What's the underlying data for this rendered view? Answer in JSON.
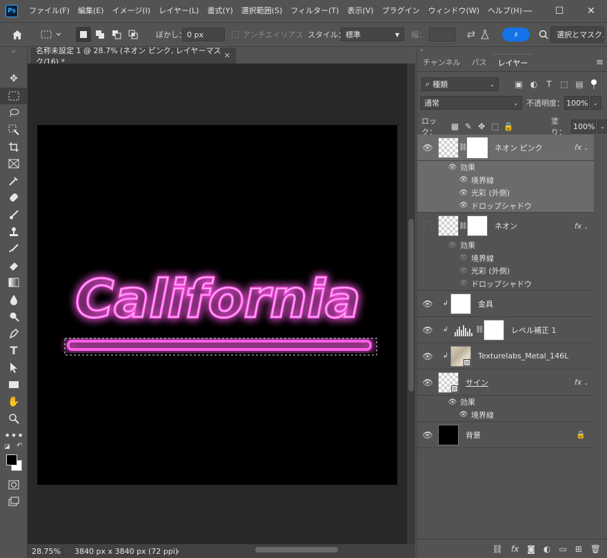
{
  "app": {
    "logo": "Ps"
  },
  "menu": [
    "ファイル(F)",
    "編集(E)",
    "イメージ(I)",
    "レイヤー(L)",
    "書式(Y)",
    "選択範囲(S)",
    "フィルター(T)",
    "表示(V)",
    "プラグイン",
    "ウィンドウ(W)",
    "ヘルプ(H)"
  ],
  "window_controls": {
    "minimize": "—",
    "maximize": "☐",
    "close": "✕"
  },
  "options": {
    "feather_label": "ぼかし：",
    "feather_value": "0 px",
    "antialias_label": "アンチエイリアス",
    "style_label": "スタイル：",
    "style_value": "標準",
    "width_label": "幅：",
    "toggle_label": "♯",
    "select_mask_label": "選択とマスク..."
  },
  "document": {
    "tab_title": "名称未設定 1 @ 28.7% (ネオン ピンク, レイヤーマスク/16) *",
    "close": "✕"
  },
  "canvas": {
    "artwork_text": "California",
    "neon_color": "#ff5ce8",
    "glow_color": "#ff2bd0"
  },
  "status": {
    "zoom": "28.75%",
    "dimensions": "3840 px x 3840 px (72 ppi)",
    "arrow": "›"
  },
  "panel": {
    "tabs": [
      "チャンネル",
      "パス",
      "レイヤー"
    ],
    "active_tab": "レイヤー",
    "filter_label": "種類",
    "blend_mode": "通常",
    "opacity_label": "不透明度：",
    "opacity_value": "100%",
    "lock_label": "ロック：",
    "fill_label": "塗り：",
    "fill_value": "100%"
  },
  "layers": [
    {
      "name": "ネオン ピンク",
      "fx": "fx",
      "effects_label": "効果",
      "effects": [
        "境界線",
        "光彩 (外側)",
        "ドロップシャドウ"
      ]
    },
    {
      "name": "ネオン",
      "fx": "fx",
      "effects_label": "効果",
      "effects": [
        "境界線",
        "光彩 (外側)",
        "ドロップシャドウ"
      ]
    },
    {
      "name": "金具"
    },
    {
      "name": "レベル補正 1"
    },
    {
      "name": "Texturelabs_Metal_146L"
    },
    {
      "name": "サイン",
      "fx": "fx",
      "effects_label": "効果",
      "effects": [
        "境界線"
      ]
    },
    {
      "name": "背景"
    }
  ],
  "icons": {
    "eye": "●",
    "chain": "⛓",
    "clip": "↲",
    "lock": "🔒",
    "fx_caret": "⌄"
  }
}
